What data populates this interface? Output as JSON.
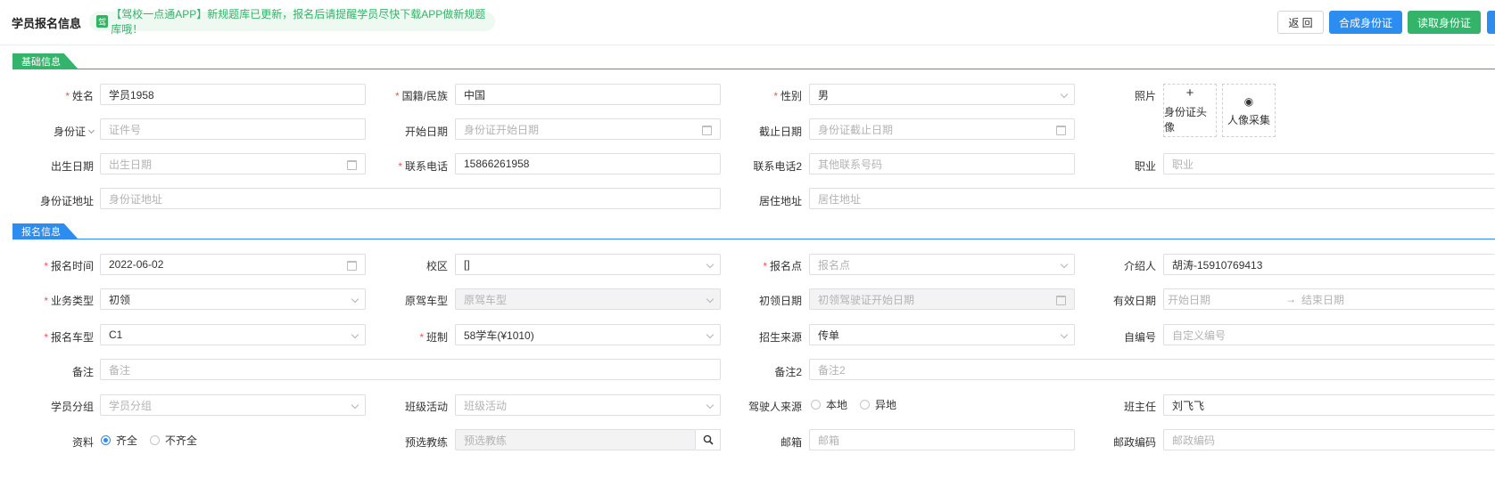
{
  "header": {
    "title": "学员报名信息",
    "notice_icon": "驾",
    "notice_text": "【驾校一点通APP】新规题库已更新，报名后请提醒学员尽快下载APP做新规题库哦！",
    "btn_back": "返 回",
    "btn_compose": "合成身份证",
    "btn_read": "读取身份证"
  },
  "basic": {
    "section_title": "基础信息",
    "name_label": "姓名",
    "name_value": "学员1958",
    "nation_label": "国籍/民族",
    "nation_value": "中国",
    "gender_label": "性别",
    "gender_value": "男",
    "photo_label": "照片",
    "photo_id_btn": "身份证头像",
    "photo_capture_btn": "人像采集",
    "idtype_label": "身份证",
    "idno_placeholder": "证件号",
    "start_label": "开始日期",
    "start_placeholder": "身份证开始日期",
    "end_label": "截止日期",
    "end_placeholder": "身份证截止日期",
    "birth_label": "出生日期",
    "birth_placeholder": "出生日期",
    "phone_label": "联系电话",
    "phone_value": "15866261958",
    "phone2_label": "联系电话2",
    "phone2_placeholder": "其他联系号码",
    "job_label": "职业",
    "job_placeholder": "职业",
    "idaddr_label": "身份证地址",
    "idaddr_placeholder": "身份证地址",
    "liveaddr_label": "居住地址",
    "liveaddr_placeholder": "居住地址"
  },
  "signup": {
    "section_title": "报名信息",
    "time_label": "报名时间",
    "time_value": "2022-06-02",
    "campus_label": "校区",
    "campus_value": "[]",
    "point_label": "报名点",
    "point_placeholder": "报名点",
    "referrer_label": "介绍人",
    "referrer_value": "胡涛-15910769413",
    "biztype_label": "业务类型",
    "biztype_value": "初领",
    "origcar_label": "原驾车型",
    "origcar_placeholder": "原驾车型",
    "firstdate_label": "初领日期",
    "firstdate_placeholder": "初领驾驶证开始日期",
    "valid_label": "有效日期",
    "valid_start_placeholder": "开始日期",
    "valid_sep": "→",
    "valid_end_placeholder": "结束日期",
    "car_label": "报名车型",
    "car_value": "C1",
    "class_label": "班制",
    "class_value": "58学车(¥1010)",
    "source_label": "招生来源",
    "source_value": "传单",
    "selfno_label": "自编号",
    "selfno_placeholder": "自定义编号",
    "remark_label": "备注",
    "remark_placeholder": "备注",
    "remark2_label": "备注2",
    "remark2_placeholder": "备注2",
    "group_label": "学员分组",
    "group_placeholder": "学员分组",
    "activity_label": "班级活动",
    "activity_placeholder": "班级活动",
    "origin_label": "驾驶人来源",
    "origin_local": "本地",
    "origin_other": "异地",
    "teacher_label": "班主任",
    "teacher_value": "刘飞飞",
    "docs_label": "资料",
    "docs_full": "齐全",
    "docs_partial": "不齐全",
    "coach_label": "预选教练",
    "coach_placeholder": "预选教练",
    "email_label": "邮箱",
    "email_placeholder": "邮箱",
    "postal_label": "邮政编码",
    "postal_placeholder": "邮政编码"
  }
}
